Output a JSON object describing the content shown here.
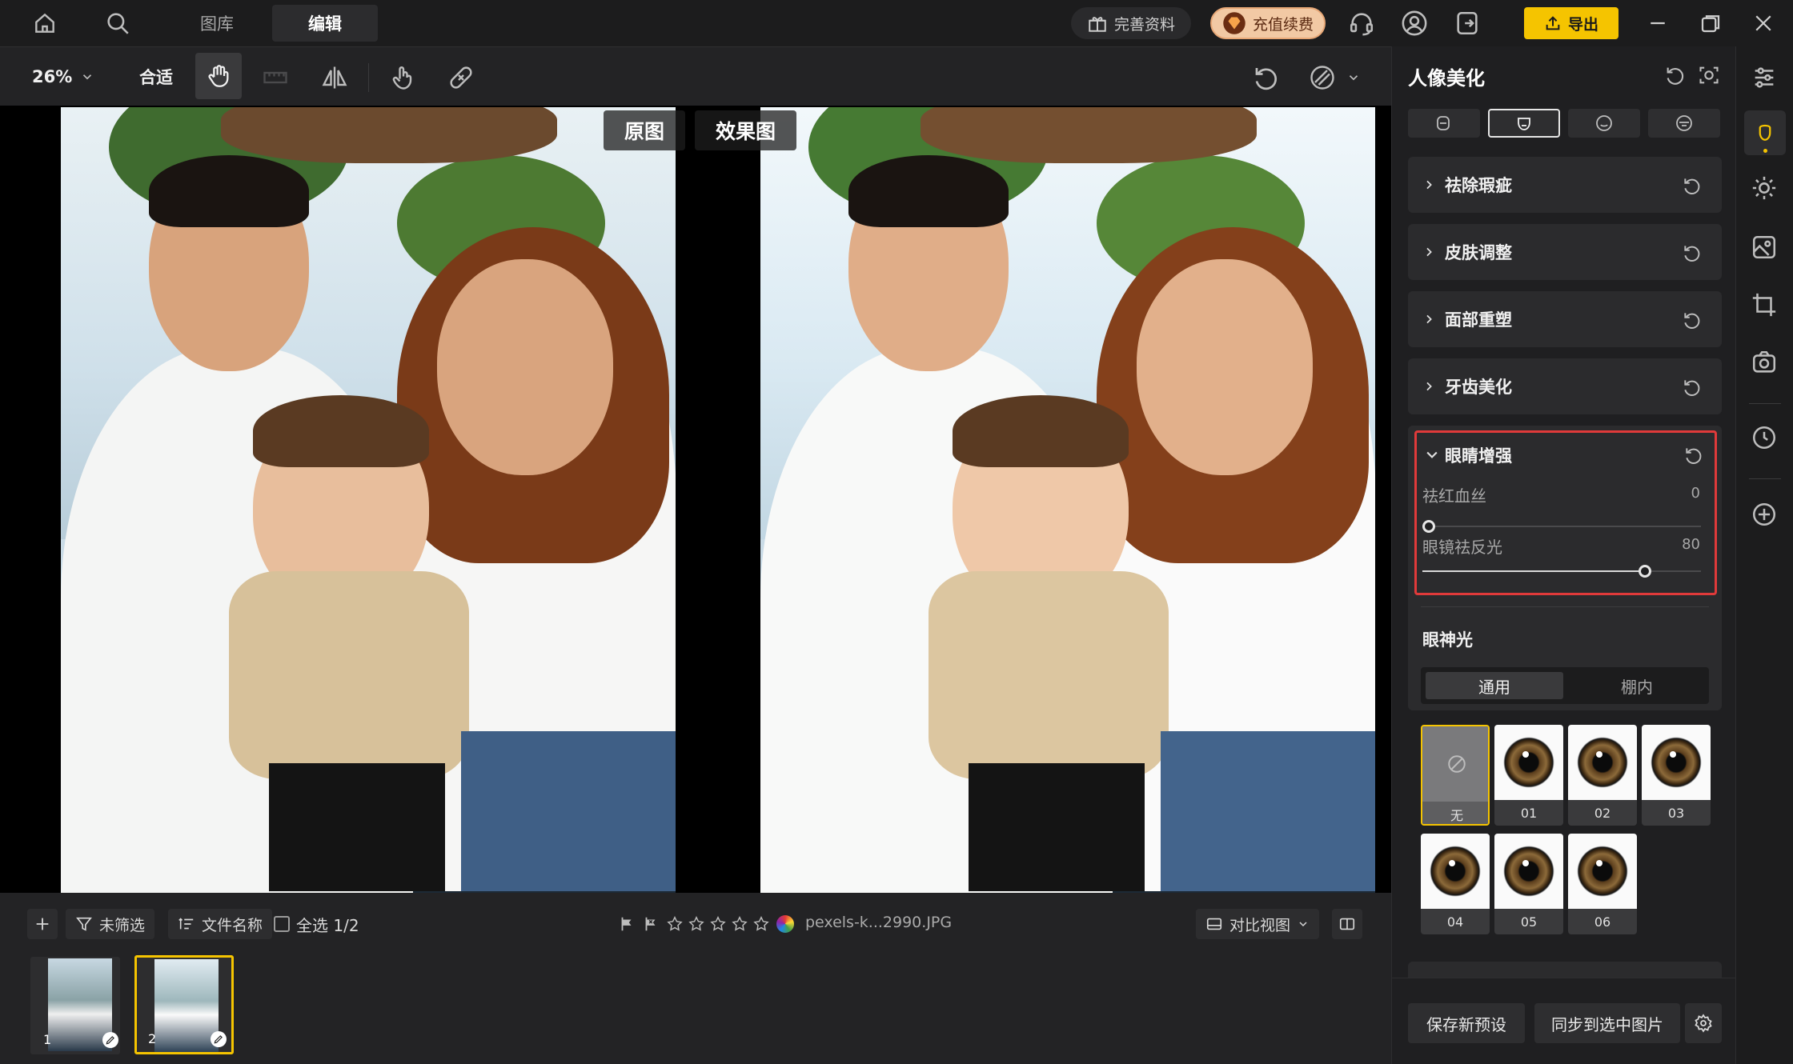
{
  "topbar": {
    "tabs": [
      "图库",
      "编辑"
    ],
    "complete_profile": "完善资料",
    "recharge": "充值续费",
    "export": "导出"
  },
  "toolbar": {
    "zoom": "26%",
    "fit": "合适"
  },
  "canvas": {
    "label_original": "原图",
    "label_effect": "效果图"
  },
  "filmstrip": {
    "filter": "未筛选",
    "sort": "文件名称",
    "select_all": "全选 1/2",
    "filename": "pexels-k...2990.JPG",
    "compare_view": "对比视图",
    "thumbs": [
      {
        "index": "1"
      },
      {
        "index": "2"
      }
    ]
  },
  "panel": {
    "title": "人像美化",
    "sections": [
      "祛除瑕疵",
      "皮肤调整",
      "面部重塑",
      "牙齿美化"
    ],
    "eye": {
      "title": "眼睛增强",
      "sliders": [
        {
          "label": "祛红血丝",
          "value": "0",
          "fraction": 0
        },
        {
          "label": "眼镜祛反光",
          "value": "80",
          "fraction": 0.8
        }
      ]
    },
    "catchlight": {
      "title": "眼神光",
      "tabs": [
        "通用",
        "棚内"
      ],
      "presets": [
        "无",
        "01",
        "02",
        "03",
        "04",
        "05",
        "06"
      ]
    },
    "save_preset": "保存新预设",
    "sync": "同步到选中图片"
  },
  "colors": {
    "accent": "#f5c400",
    "highlight": "#e03a3a"
  }
}
